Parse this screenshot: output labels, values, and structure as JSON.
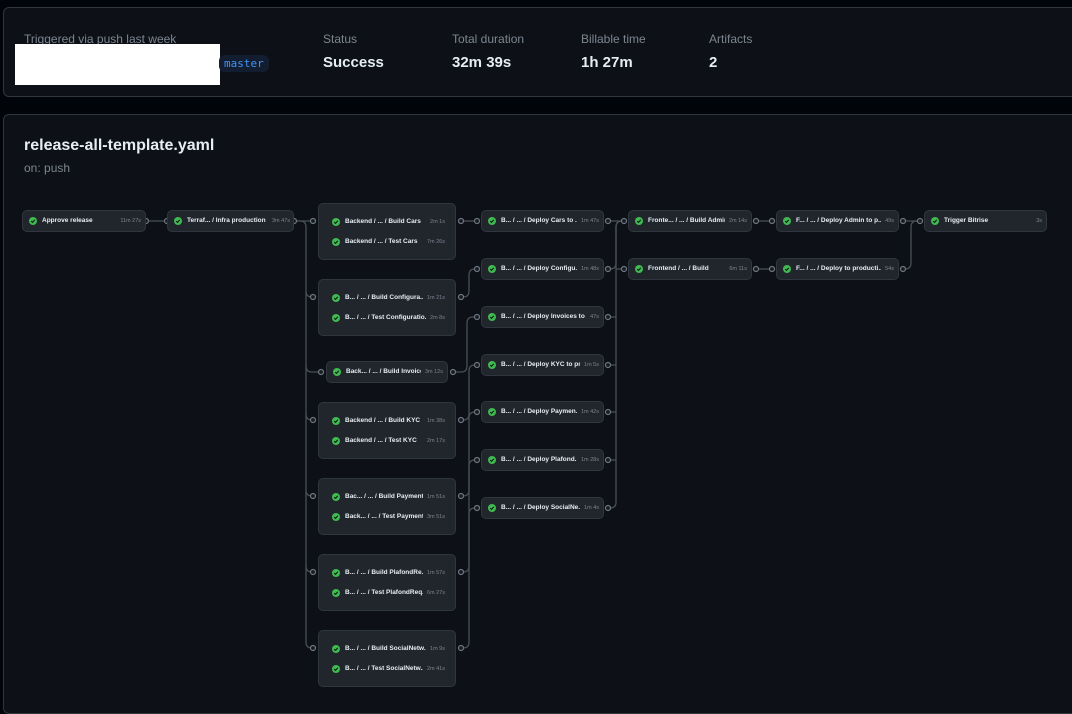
{
  "summary": {
    "trigger_label": "Triggered via push last week",
    "branch": "master",
    "status_label": "Status",
    "status_value": "Success",
    "duration_label": "Total duration",
    "duration_value": "32m 39s",
    "billable_label": "Billable time",
    "billable_value": "1h 27m",
    "artifacts_label": "Artifacts",
    "artifacts_value": "2"
  },
  "workflow": {
    "file": "release-all-template.yaml",
    "trigger": "on: push"
  },
  "colors": {
    "success": "#3fb950",
    "branch_text": "#4493f8",
    "muted": "#7d8590"
  },
  "jobs": {
    "approve_release": {
      "name": "Approve release",
      "duration": "11m 27s",
      "status": "success"
    },
    "infra_production": {
      "name": "Terraf... / Infra production",
      "duration": "3m 47s",
      "status": "success"
    },
    "build_cars": {
      "name": "Backend / ... / Build Cars",
      "duration": "2m 1s",
      "status": "success"
    },
    "test_cars": {
      "name": "Backend / ... / Test Cars",
      "duration": "7m 26s",
      "status": "success"
    },
    "build_configuration": {
      "name": "B... / ... / Build Configura...",
      "duration": "1m 21s",
      "status": "success"
    },
    "test_configuration": {
      "name": "B... / ... / Test Configuratio...",
      "duration": "2m 8s",
      "status": "success"
    },
    "build_invoices": {
      "name": "Back... / ... / Build Invoices",
      "duration": "3m 12s",
      "status": "success"
    },
    "build_kyc": {
      "name": "Backend / ... / Build KYC",
      "duration": "1m 38s",
      "status": "success"
    },
    "test_kyc": {
      "name": "Backend / ... / Test KYC",
      "duration": "2m 17s",
      "status": "success"
    },
    "build_payments": {
      "name": "Bac... / ... / Build Payments",
      "duration": "1m 51s",
      "status": "success"
    },
    "test_payments": {
      "name": "Back... / ... / Test Payments",
      "duration": "3m 51s",
      "status": "success"
    },
    "build_plafond": {
      "name": "B... / ... / Build PlafondRe...",
      "duration": "1m 57s",
      "status": "success"
    },
    "test_plafond": {
      "name": "B... / ... / Test PlafondReq...",
      "duration": "6m 27s",
      "status": "success"
    },
    "build_social": {
      "name": "B... / ... / Build SocialNetw...",
      "duration": "1m 9s",
      "status": "success"
    },
    "test_social": {
      "name": "B... / ... / Test SocialNetw...",
      "duration": "2m 41s",
      "status": "success"
    },
    "deploy_cars": {
      "name": "B... / ... / Deploy Cars to ...",
      "duration": "1m 47s",
      "status": "success"
    },
    "deploy_configuration": {
      "name": "B... / ... / Deploy Configu...",
      "duration": "1m 48s",
      "status": "success"
    },
    "deploy_invoices": {
      "name": "B... / ... / Deploy Invoices to ...",
      "duration": "47s",
      "status": "success"
    },
    "deploy_kyc": {
      "name": "B... / ... / Deploy KYC to pr...",
      "duration": "1m 5s",
      "status": "success"
    },
    "deploy_payments": {
      "name": "B... / ... / Deploy Paymen...",
      "duration": "1m 42s",
      "status": "success"
    },
    "deploy_plafond": {
      "name": "B... / ... / Deploy Plafond...",
      "duration": "1m 28s",
      "status": "success"
    },
    "deploy_social": {
      "name": "B... / ... / Deploy SocialNe...",
      "duration": "1m 4s",
      "status": "success"
    },
    "build_admin": {
      "name": "Fronte... / ... / Build Admin",
      "duration": "2m 14s",
      "status": "success"
    },
    "frontend_build": {
      "name": "Frontend / ... / Build",
      "duration": "6m 11s",
      "status": "success"
    },
    "deploy_admin": {
      "name": "F... / ... / Deploy Admin to p...",
      "duration": "49s",
      "status": "success"
    },
    "deploy_frontend": {
      "name": "F... / ... / Deploy to producti...",
      "duration": "54s",
      "status": "success"
    },
    "trigger_bitrise": {
      "name": "Trigger Bitrise",
      "duration": "3s",
      "status": "success"
    }
  }
}
